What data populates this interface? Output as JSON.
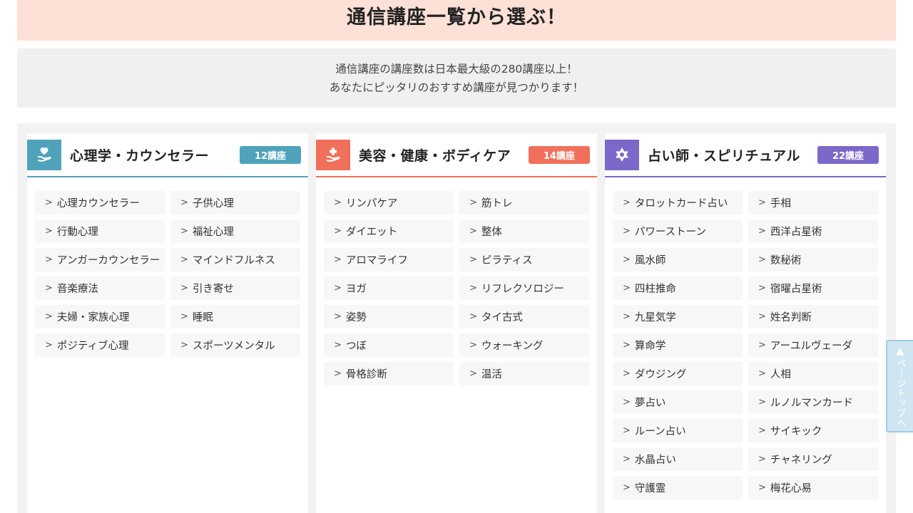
{
  "header": {
    "title": "通信講座一覧から選ぶ！"
  },
  "intro": {
    "line1": "通信講座の講座数は日本最大級の280講座以上！",
    "line2": "あなたにピッタリのおすすめ講座が見つかります！"
  },
  "colors": {
    "psychology": "#4fa2ba",
    "beauty": "#f0705c",
    "fortune": "#7b68c8",
    "title_bg": "#fde0d6"
  },
  "categories": [
    {
      "icon": "heart-hand-icon",
      "title": "心理学・カウンセラー",
      "count": "12講座",
      "items": [
        "心理カウンセラー",
        "子供心理",
        "行動心理",
        "福祉心理",
        "アンガーカウンセラー",
        "マインドフルネス",
        "音楽療法",
        "引き寄せ",
        "夫婦・家族心理",
        "睡眠",
        "ポジティブ心理",
        "スポーツメンタル"
      ]
    },
    {
      "icon": "plus-hand-icon",
      "title": "美容・健康・ボディケア",
      "count": "14講座",
      "items": [
        "リンパケア",
        "筋トレ",
        "ダイエット",
        "整体",
        "アロマライフ",
        "ピラティス",
        "ヨガ",
        "リフレクソロジー",
        "姿勢",
        "タイ古式",
        "つぼ",
        "ウォーキング",
        "骨格診断",
        "温活"
      ]
    },
    {
      "icon": "star-icon",
      "title": "占い師・スピリチュアル",
      "count": "22講座",
      "items": [
        "タロットカード占い",
        "手相",
        "パワーストーン",
        "西洋占星術",
        "風水師",
        "数秘術",
        "四柱推命",
        "宿曜占星術",
        "九星気学",
        "姓名判断",
        "算命学",
        "アーユルヴェーダ",
        "ダウジング",
        "人相",
        "夢占い",
        "ルノルマンカード",
        "ルーン占い",
        "サイキック",
        "水晶占い",
        "チャネリング",
        "守護霊",
        "梅花心易"
      ]
    }
  ],
  "page_top": {
    "arrow": "▲",
    "label": "ページトップへ"
  }
}
